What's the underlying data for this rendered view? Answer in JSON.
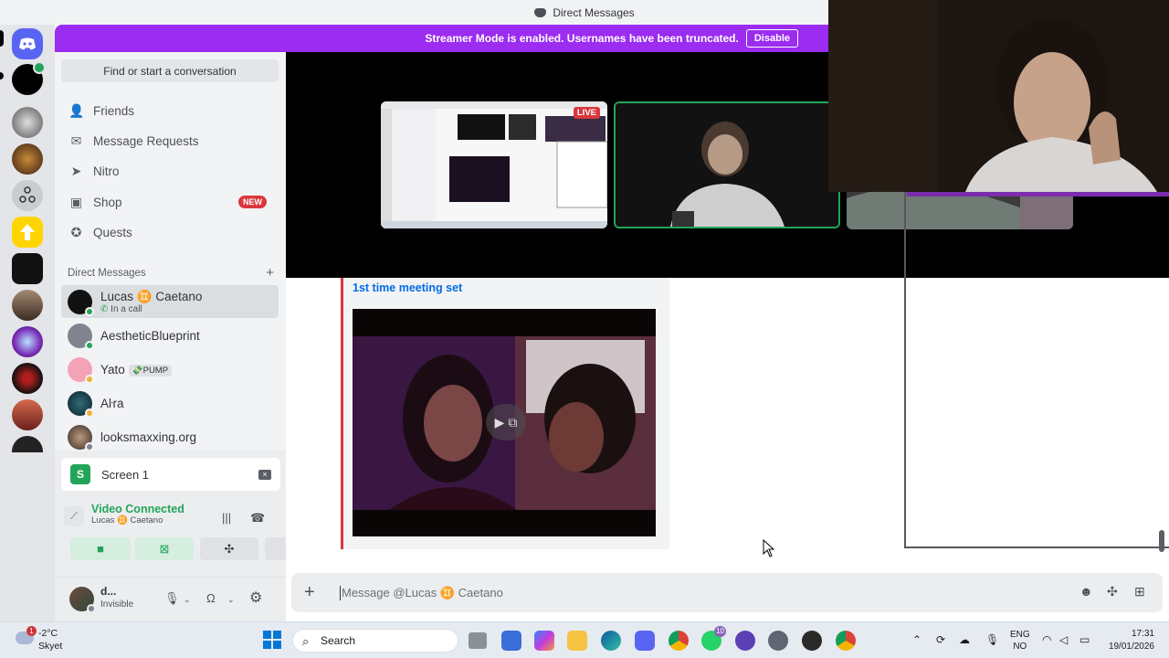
{
  "window": {
    "title": "Direct Messages"
  },
  "banner": {
    "text": "Streamer Mode is enabled. Usernames have been truncated.",
    "button": "Disable"
  },
  "sidebar": {
    "search": "Find or start a conversation",
    "nav": [
      {
        "label": "Friends",
        "icon": "friends-icon"
      },
      {
        "label": "Message Requests",
        "icon": "mail-icon"
      },
      {
        "label": "Nitro",
        "icon": "nitro-icon"
      },
      {
        "label": "Shop",
        "icon": "shop-icon",
        "badge": "NEW"
      },
      {
        "label": "Quests",
        "icon": "quests-icon"
      }
    ],
    "dm_header": "Direct Messages",
    "dm_add": "+",
    "dms": [
      {
        "name": "Lucas ♊ Caetano",
        "sub": "In a call",
        "status": "online"
      },
      {
        "name": "AestheticBlueprint",
        "status": "online"
      },
      {
        "name": "Yato",
        "badge": "💸PUMP",
        "status": "idle"
      },
      {
        "name": "Aŀra",
        "status": "idle"
      },
      {
        "name": "looksmaxxing.org",
        "status": "offline"
      }
    ]
  },
  "voice": {
    "screen_label": "Screen 1",
    "screen_badge": "S",
    "status": "Video Connected",
    "channel": "Lucas ♊ Caetano"
  },
  "user": {
    "name": "d...",
    "status": "Invisible"
  },
  "call": {
    "live_label": "LIVE"
  },
  "chat": {
    "embed_title": "1st time meeting set"
  },
  "composer": {
    "placeholder": "Message @Lucas ♊ Caetano"
  },
  "taskbar": {
    "weather_temp": "-2°C",
    "weather_desc": "Skyet",
    "weather_count": "1",
    "search": "Search",
    "lang_top": "ENG",
    "lang_bottom": "NO",
    "time": "17:31",
    "date": "19/01/2026",
    "badge_10": "10"
  },
  "colors": {
    "accent": "#9b2cf0",
    "online": "#23a559",
    "idle": "#f0b232",
    "offline": "#80848e",
    "live": "#da373c"
  }
}
